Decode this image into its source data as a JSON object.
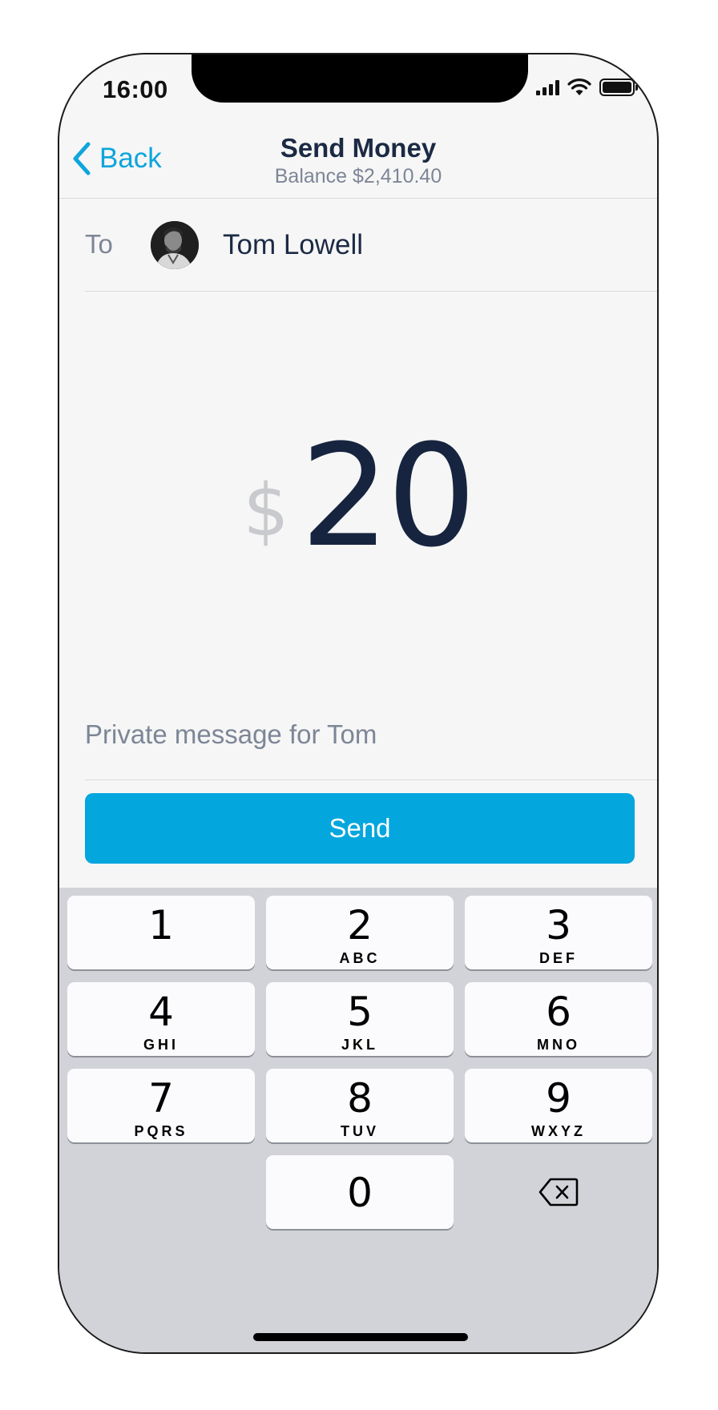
{
  "status_bar": {
    "time": "16:00"
  },
  "nav": {
    "back_label": "Back",
    "title": "Send Money",
    "subtitle": "Balance $2,410.40"
  },
  "recipient": {
    "label": "To",
    "name": "Tom Lowell"
  },
  "amount": {
    "currency": "$",
    "value": "20"
  },
  "message": {
    "placeholder": "Private message for Tom"
  },
  "send_button": {
    "label": "Send"
  },
  "keypad": {
    "keys": [
      {
        "num": "1",
        "letters": ""
      },
      {
        "num": "2",
        "letters": "ABC"
      },
      {
        "num": "3",
        "letters": "DEF"
      },
      {
        "num": "4",
        "letters": "GHI"
      },
      {
        "num": "5",
        "letters": "JKL"
      },
      {
        "num": "6",
        "letters": "MNO"
      },
      {
        "num": "7",
        "letters": "PQRS"
      },
      {
        "num": "8",
        "letters": "TUV"
      },
      {
        "num": "9",
        "letters": "WXYZ"
      },
      {
        "num": "0",
        "letters": ""
      }
    ],
    "delete_icon": "backspace-icon"
  },
  "colors": {
    "accent": "#04a6de",
    "text_dark": "#1b2a44",
    "text_muted": "#7d8697",
    "keypad_bg": "#d1d3d8"
  }
}
